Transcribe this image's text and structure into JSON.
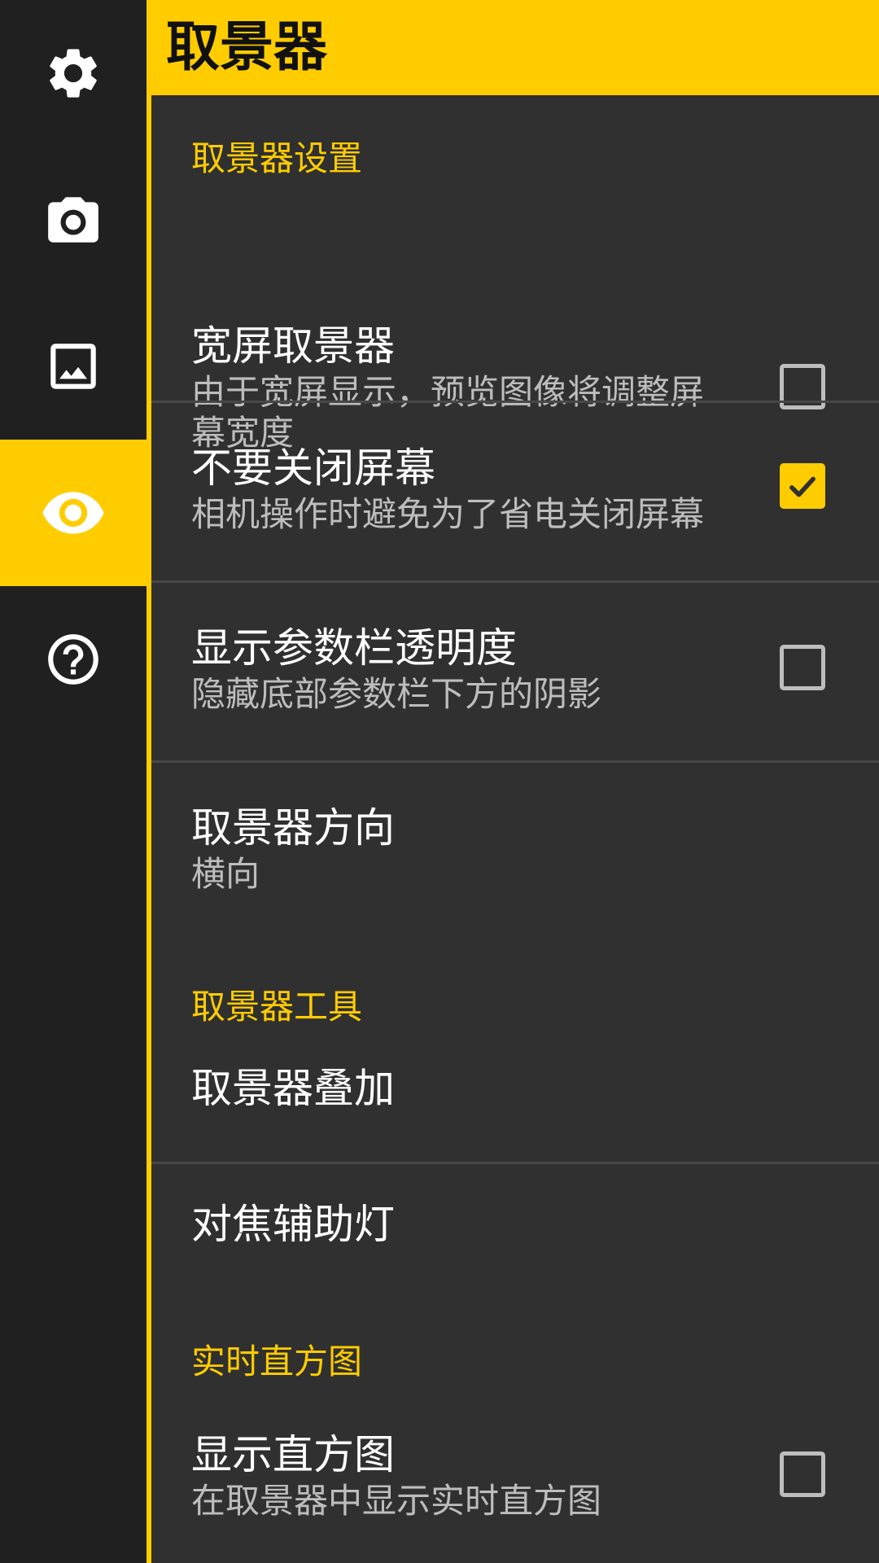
{
  "header": {
    "title": "取景器"
  },
  "sidebar": {
    "items": [
      {
        "icon": "gear-icon",
        "active": false
      },
      {
        "icon": "camera-icon",
        "active": false
      },
      {
        "icon": "image-icon",
        "active": false
      },
      {
        "icon": "eye-icon",
        "active": true
      },
      {
        "icon": "help-icon",
        "active": false
      }
    ],
    "accent": "#ffcc00"
  },
  "sections": {
    "viewfinder_settings": "取景器设置",
    "viewfinder_tools": "取景器工具",
    "live_histogram": "实时直方图"
  },
  "prefs": {
    "widescreen": {
      "title": "宽屏取景器",
      "summary": "由于宽屏显示，预览图像将调整屏幕宽度",
      "checked": false
    },
    "keep_screen_on": {
      "title": "不要关闭屏幕",
      "summary": "相机操作时避免为了省电关闭屏幕",
      "checked": true
    },
    "param_bar_transparency": {
      "title": "显示参数栏透明度",
      "summary": "隐藏底部参数栏下方的阴影",
      "checked": false
    },
    "orientation": {
      "title": "取景器方向",
      "summary": "横向"
    },
    "overlay": {
      "title": "取景器叠加"
    },
    "focus_assist": {
      "title": "对焦辅助灯"
    },
    "show_histogram": {
      "title": "显示直方图",
      "summary": "在取景器中显示实时直方图",
      "checked": false
    }
  }
}
